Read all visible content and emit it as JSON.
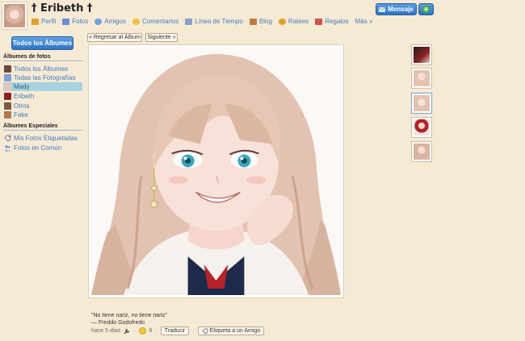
{
  "profile": {
    "name": "† Eribeth †"
  },
  "nav": [
    {
      "label": "Perfil",
      "icon": "profile-icon",
      "color": "#e0a030"
    },
    {
      "label": "Fotos",
      "icon": "photos-icon",
      "color": "#6b8fd0"
    },
    {
      "label": "Amigos",
      "icon": "friends-icon",
      "color": "#6fa0d8"
    },
    {
      "label": "Comentarios",
      "icon": "comments-icon",
      "color": "#f0c040"
    },
    {
      "label": "Línea de Tiempo",
      "icon": "timeline-icon",
      "color": "#8aa0c8"
    },
    {
      "label": "Blog",
      "icon": "blog-icon",
      "color": "#c07a40"
    },
    {
      "label": "Ratees",
      "icon": "ratees-icon",
      "color": "#e0a030"
    },
    {
      "label": "Regalos",
      "icon": "gifts-icon",
      "color": "#d05050"
    },
    {
      "label": "Más »",
      "icon": "",
      "color": ""
    }
  ],
  "actions": {
    "message": "Mensaje",
    "plus": "+"
  },
  "sidebar": {
    "all_albums": "Todos los Álbumes",
    "photo_albums_title": "Álbumes de fotos",
    "albums": [
      {
        "label": "Todos los Álbumes",
        "icon": "albums-icon",
        "active": false
      },
      {
        "label": "Todas las Fotografías",
        "icon": "photos-icon",
        "active": false
      },
      {
        "label": "Mady",
        "icon": "album-thumb-icon",
        "active": true
      },
      {
        "label": "Eribeth",
        "icon": "album-thumb-icon",
        "active": false
      },
      {
        "label": "Otros",
        "icon": "album-thumb-icon",
        "active": false
      },
      {
        "label": "Fake",
        "icon": "album-thumb-icon",
        "active": false
      }
    ],
    "special_title": "Álbumes Especiales",
    "special": [
      {
        "label": "Mis Fotos Etiquetadas",
        "icon": "tag-icon"
      },
      {
        "label": "Fotos en Común",
        "icon": "people-icon"
      }
    ]
  },
  "toolbar": {
    "back": "« Regresar al Álbum",
    "next": "Siguiente »"
  },
  "caption": {
    "quote": "\"No tiene nariz, no tiene nariz\"",
    "author": "— Freddo Godofredo"
  },
  "meta": {
    "time": "hace 5 días",
    "likes": "6",
    "translate": "Traducir",
    "tag_friend": "Etiqueta a un Amigo"
  }
}
